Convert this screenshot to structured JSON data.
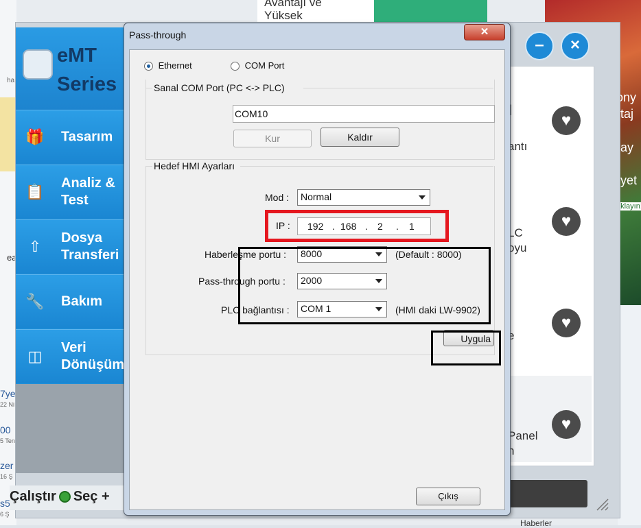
{
  "background": {
    "news_line1": "Avantajı ve",
    "news_line2": "Yüksek",
    "right_texts": [
      "ony",
      "taj",
      "ay",
      "iyet",
      "aklayın!"
    ],
    "left_fragments": [
      "ha",
      "ea",
      "7ye",
      "22 Ni",
      "00",
      "5 Ten",
      "zer",
      "16 Ş",
      "s5",
      "6 Ş"
    ],
    "right_panel_texts": [
      "I",
      "antı",
      "LC",
      "oyu",
      "e",
      "Panel",
      "n"
    ],
    "bottom_right_text": "Haberler"
  },
  "launcher": {
    "logo_line1": "eMT",
    "logo_line2": "Series",
    "nav": [
      {
        "label": "Tasarım",
        "icon": "gift-icon"
      },
      {
        "label": "Analiz &\nTest",
        "icon": "clipboard-check-icon"
      },
      {
        "label": "Dosya\nTransferi",
        "icon": "file-transfer-icon"
      },
      {
        "label": "Bakım",
        "icon": "wrench-icon"
      },
      {
        "label": "Veri\nDönüşüm",
        "icon": "data-convert-icon"
      }
    ],
    "run_label": "Çalıştır",
    "select_label": "Seç +",
    "minimize_icon": "minus-icon",
    "close_icon": "close-icon"
  },
  "dialog": {
    "title": "Pass-through",
    "mode_options": [
      {
        "label": "Ethernet",
        "selected": true
      },
      {
        "label": "COM Port",
        "selected": false
      }
    ],
    "virtual_com_group": "Sanal COM Port (PC <-> PLC)",
    "com_value": "COM10",
    "install_button": "Kur",
    "remove_button": "Kaldır",
    "target_group": "Hedef HMI Ayarları",
    "mode_label": "Mod :",
    "mode_value": "Normal",
    "ip_label": "IP :",
    "ip_octets": [
      "192",
      "168",
      "2",
      "1"
    ],
    "comm_port_label": "Haberleşme portu :",
    "comm_port_value": "8000",
    "comm_port_default": "(Default : 8000)",
    "pass_port_label": "Pass-through portu :",
    "pass_port_value": "2000",
    "plc_conn_label": "PLC bağlantısı :",
    "plc_conn_value": "COM 1",
    "plc_conn_note": "(HMI daki LW-9902)",
    "apply_button": "Uygula",
    "exit_button": "Çıkış"
  },
  "colors": {
    "annotation_red": "#e5171f",
    "sidebar_blue": "#1f8fd8"
  }
}
